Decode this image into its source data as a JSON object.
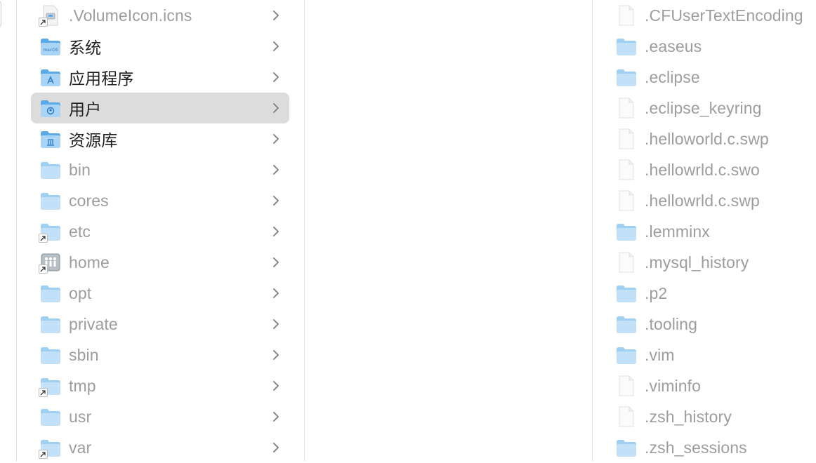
{
  "column1": {
    "items": [
      {
        "label": ".VolumeIcon.icns",
        "icon": "icns-file-alias-icon",
        "dim": true,
        "alias": true
      },
      {
        "label": "系统",
        "icon": "macos-system-folder-icon",
        "dim": false
      },
      {
        "label": "应用程序",
        "icon": "applications-folder-icon",
        "dim": false
      },
      {
        "label": "用户",
        "icon": "users-folder-icon",
        "dim": false,
        "selected": true
      },
      {
        "label": "资源库",
        "icon": "library-folder-icon",
        "dim": false
      },
      {
        "label": "bin",
        "icon": "folder-icon",
        "dim": true
      },
      {
        "label": "cores",
        "icon": "folder-icon",
        "dim": true
      },
      {
        "label": "etc",
        "icon": "folder-alias-icon",
        "dim": true,
        "alias": true
      },
      {
        "label": "home",
        "icon": "home-network-alias-icon",
        "dim": true,
        "alias": true
      },
      {
        "label": "opt",
        "icon": "folder-icon",
        "dim": true
      },
      {
        "label": "private",
        "icon": "folder-icon",
        "dim": true
      },
      {
        "label": "sbin",
        "icon": "folder-icon",
        "dim": true
      },
      {
        "label": "tmp",
        "icon": "folder-alias-icon",
        "dim": true,
        "alias": true
      },
      {
        "label": "usr",
        "icon": "folder-icon",
        "dim": true
      },
      {
        "label": "var",
        "icon": "folder-alias-icon",
        "dim": true,
        "alias": true
      }
    ],
    "chevron_icon": "chevron-right-icon"
  },
  "column3": {
    "items": [
      {
        "label": ".CFUserTextEncoding",
        "icon": "file-icon"
      },
      {
        "label": ".easeus",
        "icon": "folder-icon"
      },
      {
        "label": ".eclipse",
        "icon": "folder-icon"
      },
      {
        "label": ".eclipse_keyring",
        "icon": "file-icon"
      },
      {
        "label": ".helloworld.c.swp",
        "icon": "file-icon"
      },
      {
        "label": ".hellowrld.c.swo",
        "icon": "file-icon"
      },
      {
        "label": ".hellowrld.c.swp",
        "icon": "file-icon"
      },
      {
        "label": ".lemminx",
        "icon": "folder-icon"
      },
      {
        "label": ".mysql_history",
        "icon": "file-icon"
      },
      {
        "label": ".p2",
        "icon": "folder-icon"
      },
      {
        "label": ".tooling",
        "icon": "folder-icon"
      },
      {
        "label": ".vim",
        "icon": "folder-icon"
      },
      {
        "label": ".viminfo",
        "icon": "file-icon"
      },
      {
        "label": ".zsh_history",
        "icon": "file-icon"
      },
      {
        "label": ".zsh_sessions",
        "icon": "folder-icon"
      }
    ]
  },
  "colors": {
    "folder_light": "#a9d4f5",
    "folder_dark": "#5aa9e8",
    "folder_dim": "#c2e1f8",
    "selected_row": "#dcdcdc",
    "text_normal": "#1f1f1f",
    "text_dim": "#9d9d9d"
  }
}
